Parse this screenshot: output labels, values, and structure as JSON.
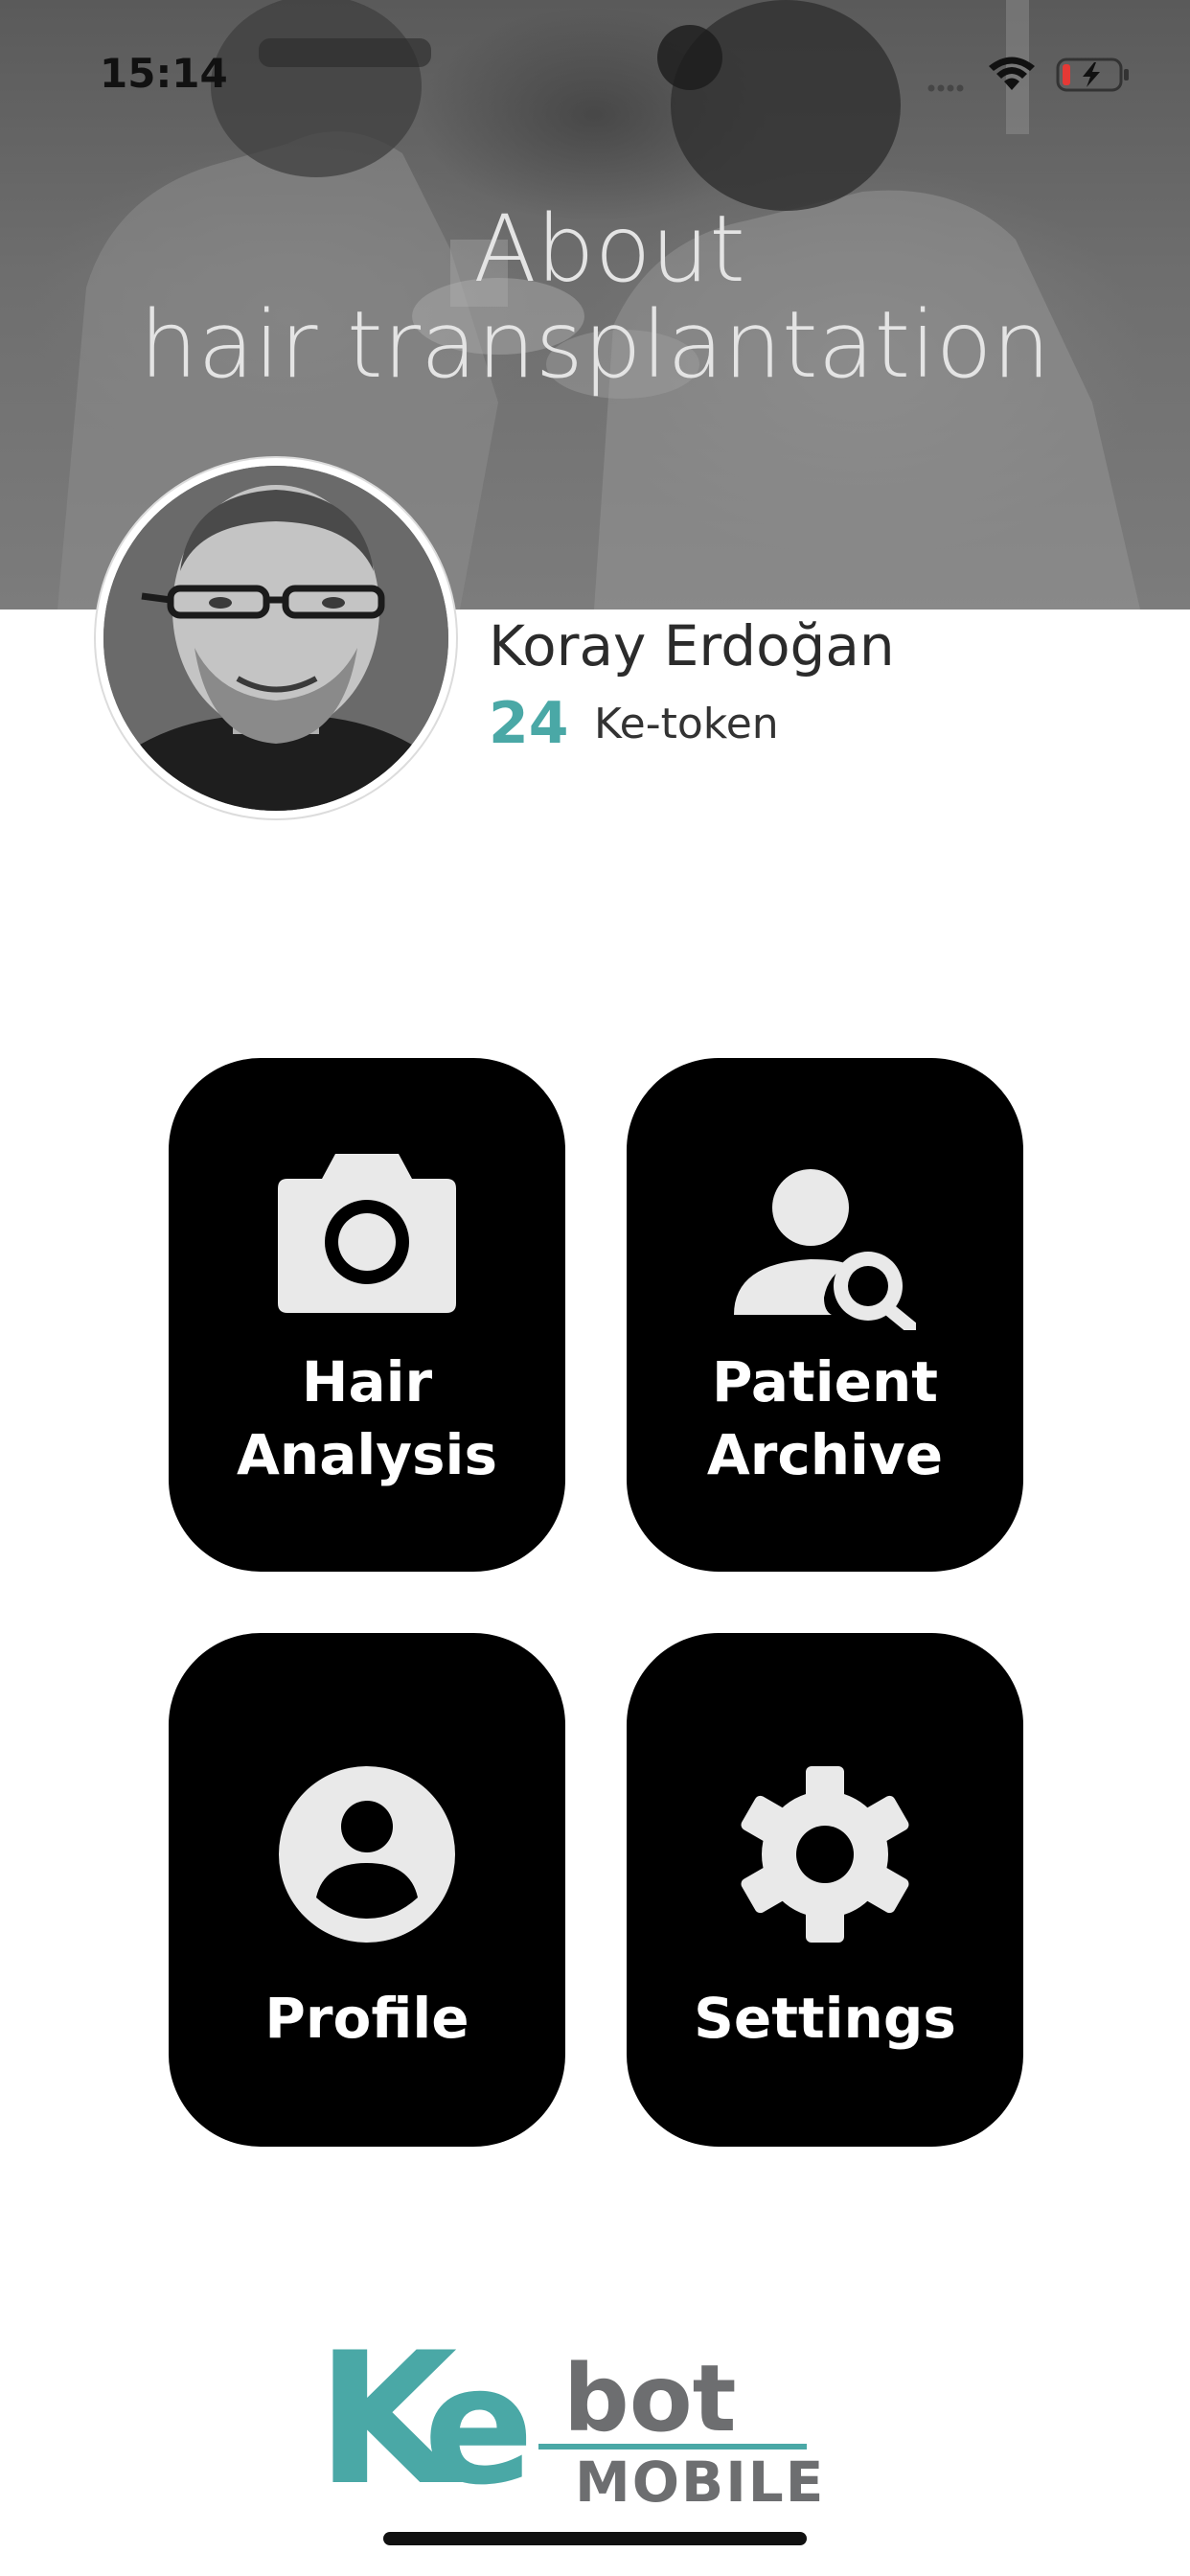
{
  "status_bar": {
    "time": "15:14",
    "icons": [
      "cellular-dots-icon",
      "wifi-icon",
      "battery-charging-icon"
    ]
  },
  "hero": {
    "title_line1": "About",
    "title_line2": "hair transplantation"
  },
  "profile": {
    "name": "Koray Erdoğan",
    "token_count": "24",
    "token_label": "Ke-token"
  },
  "tiles": [
    {
      "label_line1": "Hair",
      "label_line2": "Analysis",
      "icon": "camera-icon"
    },
    {
      "label_line1": "Patient",
      "label_line2": "Archive",
      "icon": "user-search-icon"
    },
    {
      "label_line1": "Profile",
      "icon": "account-circle-icon"
    },
    {
      "label_line1": "Settings",
      "icon": "gear-icon"
    }
  ],
  "logo": {
    "part1": "K",
    "part2": "e",
    "part3": "bot",
    "part4": "MOBILE"
  },
  "colors": {
    "accent": "#4aa8a6",
    "tile_bg": "#000000",
    "tile_text": "#ffffff",
    "icon_fill": "#e9e9e9",
    "logo_gray": "#6d6e70"
  }
}
